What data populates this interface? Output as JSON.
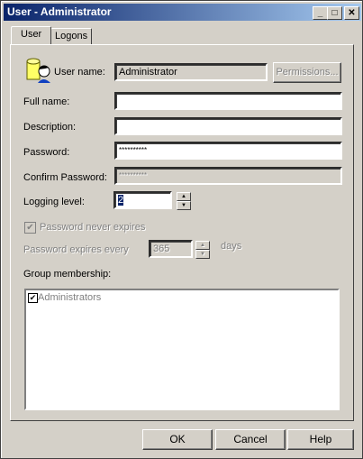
{
  "window": {
    "title": "User - Administrator",
    "minimize": "_",
    "maximize": "□",
    "close": "✕"
  },
  "tabs": [
    {
      "label": "User"
    },
    {
      "label": "Logons"
    }
  ],
  "form": {
    "user_name_label": "User name:",
    "user_name_value": "Administrator",
    "permissions": "Permissions...",
    "full_name_label": "Full name:",
    "full_name_value": "",
    "description_label": "Description:",
    "description_value": "",
    "password_label": "Password:",
    "password_value": "**********",
    "confirm_label": "Confirm Password:",
    "confirm_value": "**********",
    "logging_label": "Logging level:",
    "logging_value": "2",
    "never_expires_label": "Password never expires",
    "never_expires_checked": true,
    "expires_every_label": "Password expires every",
    "expires_every_value": "365",
    "days_label": "days",
    "group_label": "Group membership:",
    "groups": [
      {
        "name": "Administrators",
        "checked": true
      }
    ]
  },
  "buttons": {
    "ok": "OK",
    "cancel": "Cancel",
    "help": "Help"
  }
}
